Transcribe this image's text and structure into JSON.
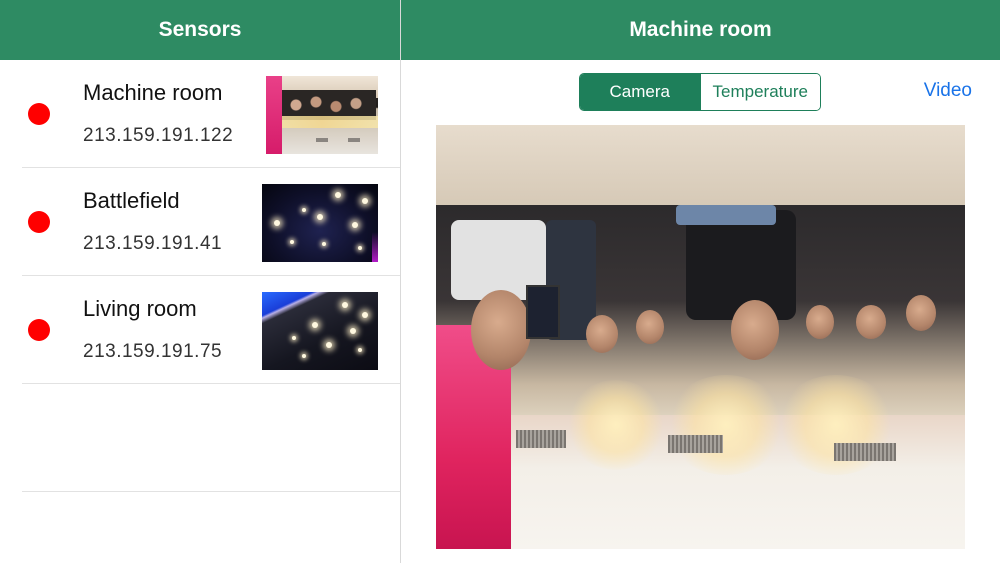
{
  "left_panel": {
    "title": "Sensors",
    "sensors": [
      {
        "name": "Machine room",
        "ip": "213.159.191.122",
        "status_color": "#ff0000"
      },
      {
        "name": "Battlefield",
        "ip": "213.159.191.41",
        "status_color": "#ff0000"
      },
      {
        "name": "Living room",
        "ip": "213.159.191.75",
        "status_color": "#ff0000"
      }
    ]
  },
  "right_panel": {
    "title": "Machine room",
    "tabs": [
      {
        "label": "Camera",
        "selected": true
      },
      {
        "label": "Temperature",
        "selected": false
      }
    ],
    "video_link": "Video"
  },
  "colors": {
    "navbar": "#2e8b63",
    "segment_active": "#1e7f5a",
    "link": "#1a73e8",
    "status_offline": "#ff0000"
  },
  "icons": {
    "status": "status-dot-icon"
  }
}
